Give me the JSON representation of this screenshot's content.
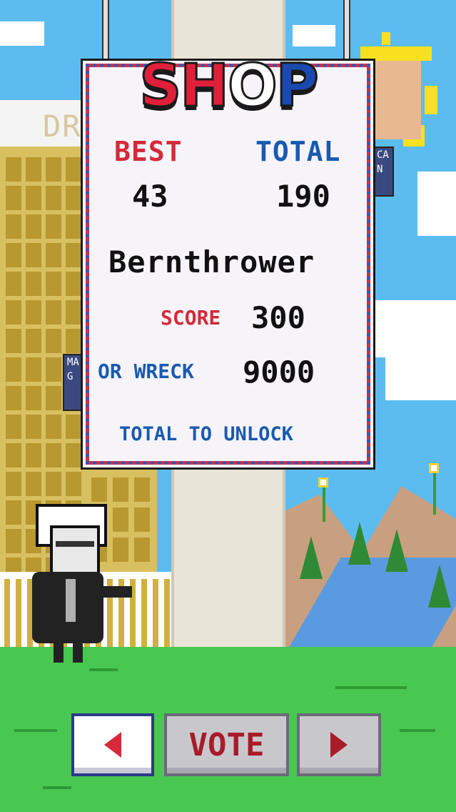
{
  "shop": {
    "title_letters": [
      {
        "char": "S",
        "color": "#e0203a"
      },
      {
        "char": "H",
        "color": "#e0203a"
      },
      {
        "char": "O",
        "color": "#ffffff"
      },
      {
        "char": "P",
        "color": "#1a4ab0"
      }
    ],
    "best_label": "BEST",
    "total_label": "TOTAL",
    "best_value": "43",
    "total_value": "190",
    "character_name": "Bernthrower",
    "score_label": "SCORE",
    "score_value": "300",
    "wreck_label": "OR WRECK",
    "wreck_value": "9000",
    "unlock_note": "TOTAL TO UNLOCK"
  },
  "background": {
    "tower_sign": "DRU",
    "banner_left": [
      "MA",
      "G"
    ],
    "banner_right": [
      "CA",
      "N"
    ]
  },
  "controls": {
    "prev_icon": "arrow-left-icon",
    "vote_label": "VOTE",
    "next_icon": "arrow-right-icon"
  },
  "colors": {
    "sky": "#5cbcf0",
    "grass": "#48c850",
    "red": "#d42a3a",
    "blue": "#1a5ab0",
    "panel": "#f6f4f8"
  }
}
